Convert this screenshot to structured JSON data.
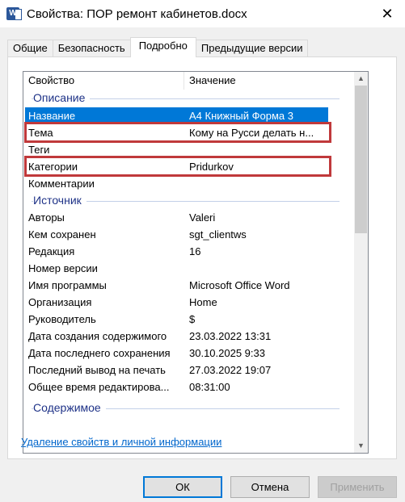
{
  "window": {
    "title": "Свойства: ПОР ремонт кабинетов.docx",
    "app_icon": "word-doc-icon",
    "app_icon_letter": "W",
    "close_glyph": "✕"
  },
  "tabs": [
    {
      "label": "Общие",
      "active": false
    },
    {
      "label": "Безопасность",
      "active": false
    },
    {
      "label": "Подробно",
      "active": true
    },
    {
      "label": "Предыдущие версии",
      "active": false
    }
  ],
  "list": {
    "header": {
      "property": "Свойство",
      "value": "Значение"
    },
    "groups": {
      "description": "Описание",
      "source": "Источник",
      "content": "Содержимое"
    },
    "description_rows": [
      {
        "property": "Название",
        "value": "A4 Книжный Форма 3"
      },
      {
        "property": "Тема",
        "value": "Кому на Русси делать н..."
      },
      {
        "property": "Теги",
        "value": ""
      },
      {
        "property": "Категории",
        "value": "Pridurkov"
      },
      {
        "property": "Комментарии",
        "value": ""
      }
    ],
    "source_rows": [
      {
        "property": "Авторы",
        "value": "Valeri"
      },
      {
        "property": "Кем сохранен",
        "value": "sgt_clientws"
      },
      {
        "property": "Редакция",
        "value": "16"
      },
      {
        "property": "Номер версии",
        "value": ""
      },
      {
        "property": "Имя программы",
        "value": "Microsoft Office Word"
      },
      {
        "property": "Организация",
        "value": "Home"
      },
      {
        "property": "Руководитель",
        "value": "$"
      },
      {
        "property": "Дата создания содержимого",
        "value": "23.03.2022 13:31"
      },
      {
        "property": "Дата последнего сохранения",
        "value": "30.10.2025 9:33"
      },
      {
        "property": "Последний вывод на печать",
        "value": "27.03.2022 19:07"
      },
      {
        "property": "Общее время редактирова...",
        "value": "08:31:00"
      }
    ],
    "selected_row": "Название",
    "highlighted_rows": [
      "Тема",
      "Категории"
    ],
    "scroll_up": "▲",
    "scroll_down": "▼"
  },
  "link": "Удаление свойств и личной информации",
  "buttons": {
    "ok": "ОК",
    "cancel": "Отмена",
    "apply": "Применить",
    "apply_enabled": false
  },
  "colors": {
    "selection": "#0078d7",
    "highlight_border": "#c0393b",
    "group_label": "#1e3287",
    "link": "#0066cc"
  }
}
